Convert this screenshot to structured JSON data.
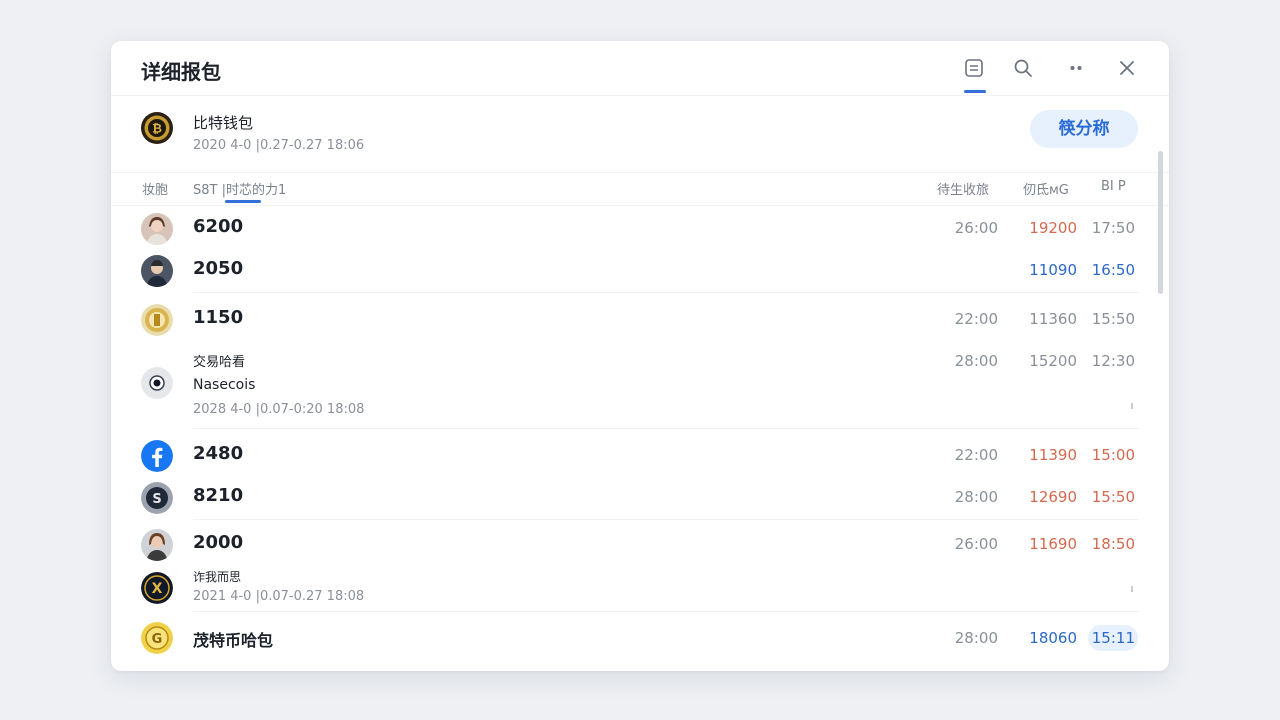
{
  "header": {
    "title": "详细报包"
  },
  "wallet": {
    "name": "比特钱包",
    "date": "2020  4-0 |0.27-0.27  18:06",
    "button_label": "筷分称"
  },
  "columns": {
    "left_a": "妆胞",
    "left_b": "S8T |时芯的力1",
    "right_a": "待生收旅",
    "right_b": "仞氐ᴍG",
    "right_c": "BI  P"
  },
  "rows": [
    {
      "amount": "6200",
      "v1": "26:00",
      "v2": "19200",
      "v3": "17:50"
    },
    {
      "amount": "2050",
      "v1": "",
      "v2": "11090",
      "v3": "16:50"
    },
    {
      "amount": "1150",
      "v1": "22:00",
      "v2": "11360",
      "v3": "15:50"
    },
    {
      "label": "交易哈看",
      "sub": "Nasecois",
      "date": "2028  4-0 |0.07-0:20  18:08",
      "v1": "28:00",
      "v2": "15200",
      "v3": "12:30"
    },
    {
      "amount": "2480",
      "v1": "22:00",
      "v2": "11390",
      "v3": "15:00"
    },
    {
      "amount": "8210",
      "v1": "28:00",
      "v2": "12690",
      "v3": "15:50"
    },
    {
      "amount": "2000",
      "v1": "26:00",
      "v2": "11690",
      "v3": "18:50"
    },
    {
      "label": "诈我而思",
      "date": "2021  4-0 |0.07-0.27  18:08"
    },
    {
      "label": "茂特币哈包",
      "v1": "28:00",
      "v2": "18060",
      "v3": "15:11"
    }
  ],
  "icons": [
    "list-icon",
    "search-icon",
    "more-icon",
    "close-icon",
    "bitcoin-logo",
    "facebook-icon"
  ],
  "colors": {
    "accent": "#3370d8",
    "up_red": "#d4694f",
    "down_blue": "#2c68c9"
  }
}
